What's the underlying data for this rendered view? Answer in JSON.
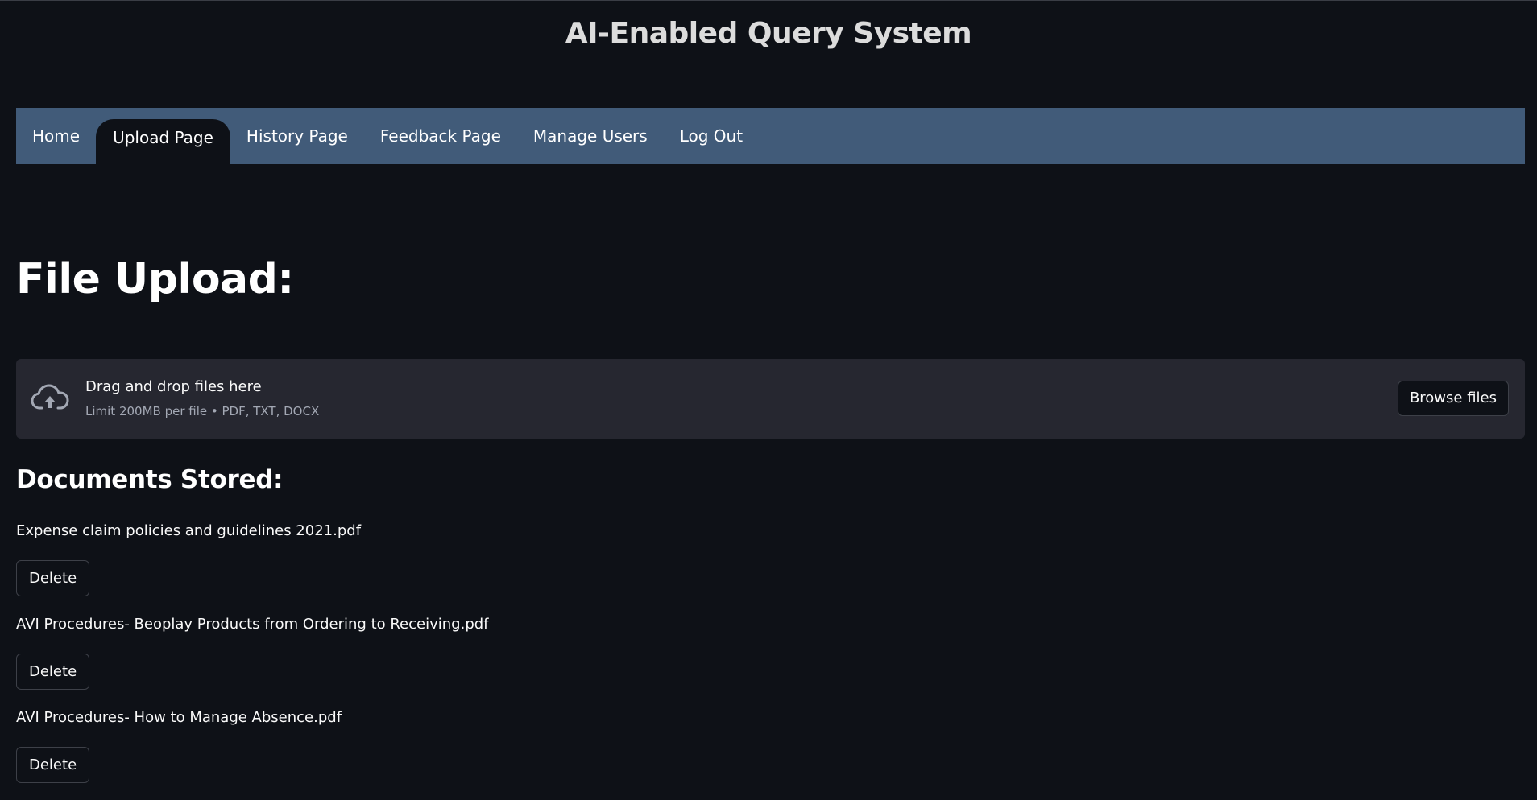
{
  "app": {
    "title": "AI-Enabled Query System"
  },
  "nav": {
    "items": [
      {
        "label": "Home",
        "active": false
      },
      {
        "label": "Upload Page",
        "active": true
      },
      {
        "label": "History Page",
        "active": false
      },
      {
        "label": "Feedback Page",
        "active": false
      },
      {
        "label": "Manage Users",
        "active": false
      },
      {
        "label": "Log Out",
        "active": false
      }
    ]
  },
  "upload": {
    "heading": "File Upload:",
    "drop_title": "Drag and drop files here",
    "drop_limit": "Limit 200MB per file • PDF, TXT, DOCX",
    "browse_label": "Browse files",
    "icon": "cloud-upload-icon"
  },
  "documents": {
    "heading": "Documents Stored:",
    "delete_label": "Delete",
    "items": [
      "Expense claim policies and guidelines 2021.pdf",
      "AVI Procedures- Beoplay Products from Ordering to Receiving.pdf",
      "AVI Procedures- How to Manage Absence.pdf"
    ]
  },
  "colors": {
    "background": "#0e1117",
    "navbar": "#415b79",
    "dropzone": "#262730"
  }
}
